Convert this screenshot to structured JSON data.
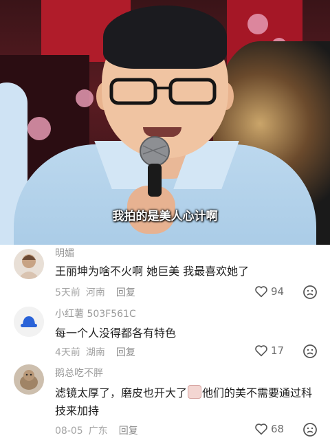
{
  "video": {
    "subtitle": "我拍的是美人心计啊"
  },
  "comments": [
    {
      "username": "明媚",
      "text": "王丽坤为啥不火啊 她巨美 我最喜欢她了",
      "time": "5天前",
      "location": "河南",
      "reply_label": "回复",
      "likes": "94"
    },
    {
      "username": "小红薯 503F561C",
      "text": "每一个人没得都各有特色",
      "time": "4天前",
      "location": "湖南",
      "reply_label": "回复",
      "likes": "17"
    },
    {
      "username": "鹅总吃不胖",
      "text_before_emoji": "滤镜太厚了，磨皮也开大了",
      "text_after_emoji": "他们的美不需要通过科技来加持",
      "time": "08-05",
      "location": "广东",
      "reply_label": "回复",
      "likes": "68"
    }
  ],
  "icons": {
    "like": "heart-outline-icon",
    "dislike": "unhappy-face-icon"
  },
  "colors": {
    "username": "#9a9a9a",
    "text": "#1e1e1e",
    "meta": "#a5a5a5"
  }
}
